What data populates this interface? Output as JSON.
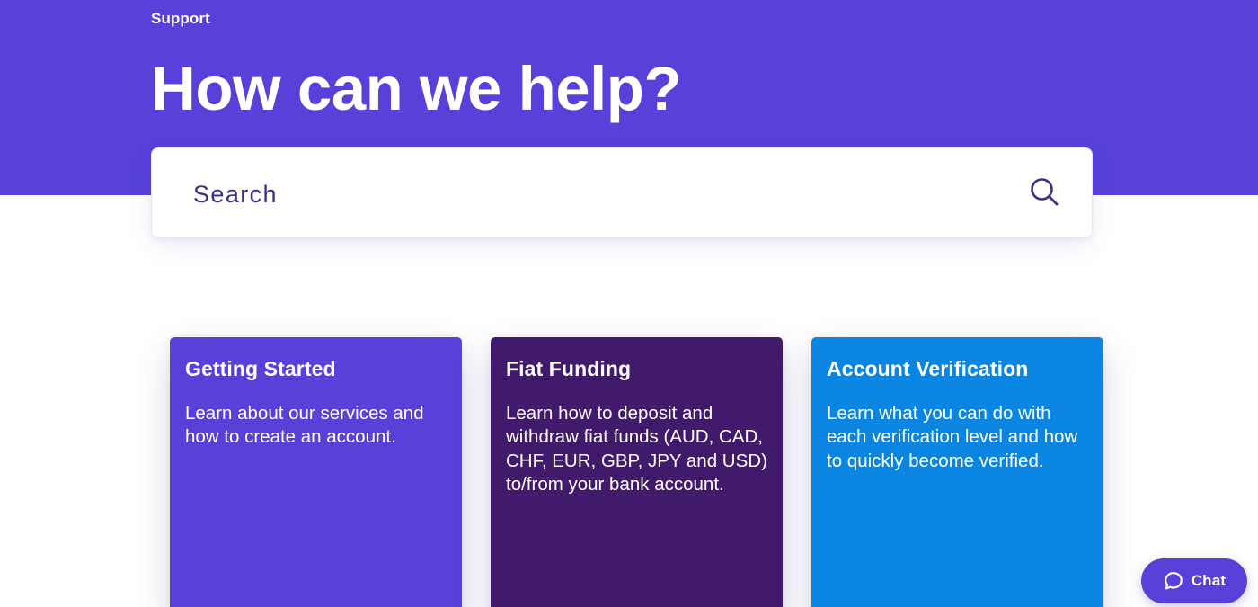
{
  "header": {
    "breadcrumb": "Support",
    "title": "How can we help?"
  },
  "search": {
    "placeholder": "Search",
    "value": ""
  },
  "cards": [
    {
      "title": "Getting Started",
      "description": "Learn about our services and how to create an account."
    },
    {
      "title": "Fiat Funding",
      "description": "Learn how to deposit and withdraw fiat funds (AUD, CAD, CHF, EUR, GBP, JPY and USD) to/from your bank account."
    },
    {
      "title": "Account Verification",
      "description": "Learn what you can do with each verification level and how to quickly become verified."
    }
  ],
  "chat": {
    "label": "Chat",
    "icon": "chat-bubble-icon"
  },
  "icons": {
    "search": "search-icon"
  },
  "colors": {
    "brand": "#5741d9",
    "card_funding": "#421a6b",
    "card_verification": "#0a86e2",
    "search_text": "#3b2f8a"
  }
}
